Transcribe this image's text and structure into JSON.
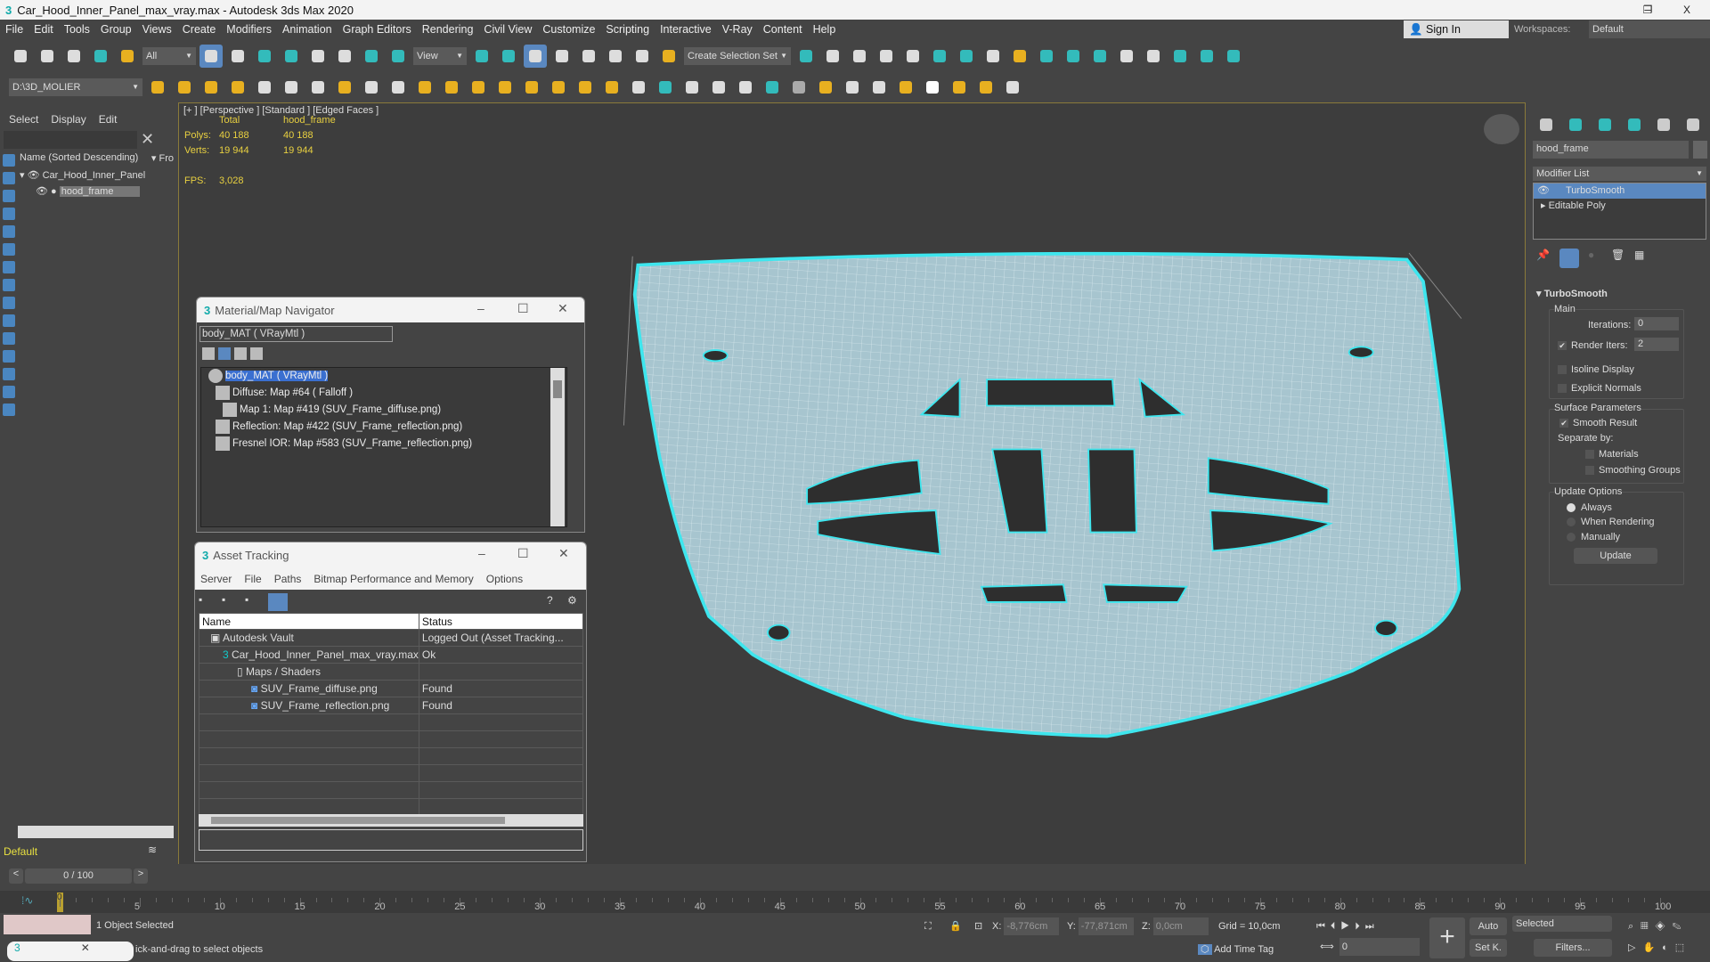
{
  "window": {
    "title": "Car_Hood_Inner_Panel_max_vray.max - Autodesk 3ds Max 2020",
    "logo": "3",
    "minimize": "–",
    "restore": "❐",
    "close": "X"
  },
  "menu": [
    "File",
    "Edit",
    "Tools",
    "Group",
    "Views",
    "Create",
    "Modifiers",
    "Animation",
    "Graph Editors",
    "Rendering",
    "Civil View",
    "Customize",
    "Scripting",
    "Interactive",
    "V-Ray",
    "Content",
    "Help"
  ],
  "account": {
    "sign_in": "Sign In",
    "workspaces_label": "Workspaces:",
    "workspace": "Default"
  },
  "toolbar": {
    "filter": "All",
    "view": "View",
    "selection_set": "Create Selection Set",
    "project": "D:\\3D_MOLIER"
  },
  "scene_explorer": {
    "menu": [
      "Select",
      "Display",
      "Edit"
    ],
    "column": "Name (Sorted Descending)",
    "column2": "▾ Fro",
    "items": [
      {
        "name": "Car_Hood_Inner_Panel"
      },
      {
        "name": "hood_frame"
      }
    ],
    "layer": "Default"
  },
  "viewport": {
    "label": "[+ ] [Perspective ] [Standard ] [Edged Faces ]",
    "stats": {
      "col_total": "Total",
      "col_object": "hood_frame",
      "polys_label": "Polys:",
      "polys_total": "40 188",
      "polys_obj": "40 188",
      "verts_label": "Verts:",
      "verts_total": "19 944",
      "verts_obj": "19 944",
      "fps_label": "FPS:",
      "fps": "3,028"
    }
  },
  "material_navigator": {
    "title": "Material/Map Navigator",
    "field": "body_MAT  ( VRayMtl )",
    "tree": [
      "body_MAT  ( VRayMtl )",
      "Diffuse: Map #64  ( Falloff )",
      "Map 1: Map #419 (SUV_Frame_diffuse.png)",
      "Reflection: Map #422 (SUV_Frame_reflection.png)",
      "Fresnel IOR: Map #583 (SUV_Frame_reflection.png)"
    ]
  },
  "asset_tracking": {
    "title": "Asset Tracking",
    "menu": [
      "Server",
      "File",
      "Paths",
      "Bitmap Performance and Memory",
      "Options"
    ],
    "columns": [
      "Name",
      "Status"
    ],
    "rows": [
      {
        "name": "Autodesk Vault",
        "status": "Logged Out (Asset Tracking..."
      },
      {
        "name": "Car_Hood_Inner_Panel_max_vray.max",
        "status": "Ok"
      },
      {
        "name": "Maps / Shaders",
        "status": ""
      },
      {
        "name": "SUV_Frame_diffuse.png",
        "status": "Found"
      },
      {
        "name": "SUV_Frame_reflection.png",
        "status": "Found"
      }
    ]
  },
  "command_panel": {
    "object_name": "hood_frame",
    "modifier_list": "Modifier List",
    "stack": [
      "TurboSmooth",
      "Editable Poly"
    ],
    "rollout": "TurboSmooth",
    "main": "Main",
    "iterations_label": "Iterations:",
    "iterations": "0",
    "render_iters_label": "Render Iters:",
    "render_iters": "2",
    "render_iters_checked": true,
    "isoline": "Isoline Display",
    "explicit_normals": "Explicit Normals",
    "surface_params": "Surface Parameters",
    "smooth_result": "Smooth Result",
    "separate_by": "Separate by:",
    "materials": "Materials",
    "smoothing_groups": "Smoothing Groups",
    "update_options": "Update Options",
    "always": "Always",
    "when_rendering": "When Rendering",
    "manually": "Manually",
    "update": "Update"
  },
  "timeline": {
    "frame": "0 / 100",
    "current": "0",
    "ticks": [
      "5",
      "10",
      "15",
      "20",
      "25",
      "30",
      "35",
      "40",
      "45",
      "50",
      "55",
      "60",
      "65",
      "70",
      "75",
      "80",
      "85",
      "90",
      "95",
      "100"
    ]
  },
  "status": {
    "selection": "1 Object Selected",
    "prompt": "ick-and-drag to select objects",
    "x_label": "X:",
    "x": "-8,776cm",
    "y_label": "Y:",
    "y": "-77,871cm",
    "z_label": "Z:",
    "z": "0,0cm",
    "grid": "Grid = 10,0cm",
    "add_time_tag": "Add Time Tag",
    "frame_field": "0",
    "auto": "Auto",
    "set_key": "Set K.",
    "key_filter": "Selected",
    "filters": "Filters..."
  },
  "colors": {
    "accent": "#5a88c0",
    "mesh": "#a8c6d0",
    "outline": "#3ee6ee",
    "stats": "#e8d040"
  }
}
